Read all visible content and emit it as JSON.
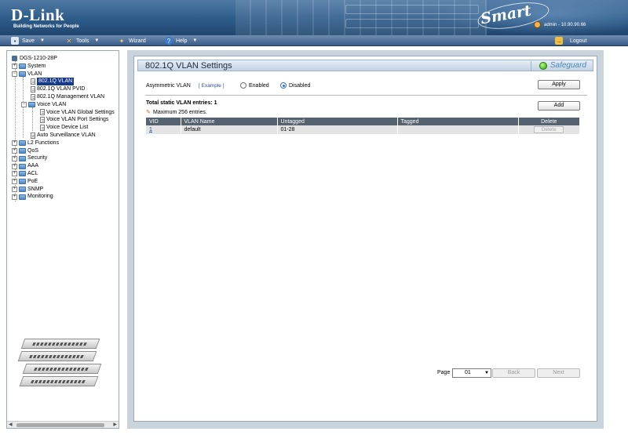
{
  "header": {
    "brand": "D-Link",
    "tagline": "Building Networks for People",
    "badge": "Smart",
    "user": "admin - 10.90.90.66"
  },
  "menubar": {
    "save": "Save",
    "tools": "Tools",
    "wizard": "Wizard",
    "help": "Help",
    "logout": "Logout"
  },
  "tree": {
    "root": "DGS-1210-28P",
    "system": "System",
    "vlan": "VLAN",
    "vlan_8021q": "802.1Q VLAN",
    "vlan_pvid": "802.1Q VLAN PVID",
    "vlan_mgmt": "802.1Q Management VLAN",
    "voice_vlan": "Voice VLAN",
    "voice_global": "Voice VLAN Global Settings",
    "voice_port": "Voice VLAN Port Settings",
    "voice_device": "Voice Device List",
    "auto_surv": "Auto Surveillance VLAN",
    "l2": "L2 Functions",
    "qos": "QoS",
    "security": "Security",
    "aaa": "AAA",
    "acl": "ACL",
    "poe": "PoE",
    "snmp": "SNMP",
    "monitoring": "Monitoring"
  },
  "main": {
    "title": "802.1Q VLAN Settings",
    "safeguard": "Safeguard",
    "asym_label": "Asymmetric VLAN",
    "example": "[ Example ]",
    "enabled": "Enabled",
    "disabled": "Disabled",
    "asym_selected": "Disabled",
    "apply": "Apply",
    "add": "Add",
    "total_entries": "Total static VLAN entries: 1",
    "max_entries": "Maximum 256 entries.",
    "columns": {
      "vid": "VID",
      "name": "VLAN Name",
      "untagged": "Untagged",
      "tagged": "Tagged",
      "delete": "Delete"
    },
    "rows": [
      {
        "vid": "1",
        "name": "default",
        "untagged": "01-28",
        "tagged": "",
        "delete": "Delete"
      }
    ],
    "page_label": "Page",
    "page_value": "01",
    "back": "Back",
    "next": "Next"
  },
  "colors": {
    "accent": "#2d5b89",
    "selected_tree": "#173b8c",
    "table_header": "#55626f",
    "safeguard_green": "#2ca11a"
  }
}
